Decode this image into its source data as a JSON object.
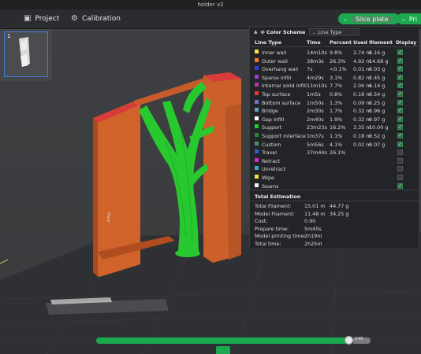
{
  "window": {
    "title": "holder v2"
  },
  "toolbar": {
    "project_label": "Project",
    "calibration_label": "Calibration",
    "slice_label": "Slice plate",
    "print_label": "Pri"
  },
  "plate": {
    "number": "1"
  },
  "legend": {
    "title": "Color Scheme",
    "scheme_value": "Line Type",
    "columns": [
      "Line Type",
      "Time",
      "Percent",
      "Used filament",
      "Display"
    ],
    "rows": [
      {
        "name": "Inner wall",
        "time": "14m10s",
        "percent": "9.8%",
        "len": "2.74 m",
        "weight": "8.16 g",
        "color": "#f3e54b",
        "display": true
      },
      {
        "name": "Outer wall",
        "time": "38m3s",
        "percent": "26.3%",
        "len": "4.92 m",
        "weight": "14.68 g",
        "color": "#f07a2a",
        "display": true
      },
      {
        "name": "Overhang wall",
        "time": "7s",
        "percent": "<0.1%",
        "len": "0.01 m",
        "weight": "0.03 g",
        "color": "#2a3ee0",
        "display": true
      },
      {
        "name": "Sparse infill",
        "time": "4m29s",
        "percent": "3.1%",
        "len": "0.82 m",
        "weight": "2.45 g",
        "color": "#a33ad0",
        "display": true
      },
      {
        "name": "Internal solid infill",
        "time": "11m10s",
        "percent": "7.7%",
        "len": "2.06 m",
        "weight": "6.14 g",
        "color": "#b23a9a",
        "display": true
      },
      {
        "name": "Top surface",
        "time": "1m5s",
        "percent": "0.8%",
        "len": "0.18 m",
        "weight": "0.54 g",
        "color": "#e0373b",
        "display": true
      },
      {
        "name": "Bottom surface",
        "time": "1m50s",
        "percent": "1.3%",
        "len": "0.09 m",
        "weight": "0.25 g",
        "color": "#6c76c7",
        "display": true
      },
      {
        "name": "Bridge",
        "time": "2m30s",
        "percent": "1.7%",
        "len": "0.32 m",
        "weight": "0.96 g",
        "color": "#5aa2b2",
        "display": true
      },
      {
        "name": "Gap infill",
        "time": "2m40s",
        "percent": "1.9%",
        "len": "0.32 m",
        "weight": "0.97 g",
        "color": "#ffffff",
        "display": true
      },
      {
        "name": "Support",
        "time": "23m23s",
        "percent": "16.2%",
        "len": "3.35 m",
        "weight": "10.00 g",
        "color": "#22cc2a",
        "display": true
      },
      {
        "name": "Support interface",
        "time": "1m37s",
        "percent": "1.1%",
        "len": "0.18 m",
        "weight": "0.52 g",
        "color": "#2a8a2e",
        "display": true
      },
      {
        "name": "Custom",
        "time": "5m56s",
        "percent": "4.1%",
        "len": "0.02 m",
        "weight": "0.07 g",
        "color": "#4c8f72",
        "display": true
      },
      {
        "name": "Travel",
        "time": "37m44s",
        "percent": "26.1%",
        "len": "",
        "weight": "",
        "color": "#2b62c8",
        "display": false
      },
      {
        "name": "Retract",
        "time": "",
        "percent": "",
        "len": "",
        "weight": "",
        "color": "#cc2ad0",
        "display": false
      },
      {
        "name": "Unretract",
        "time": "",
        "percent": "",
        "len": "",
        "weight": "",
        "color": "#3aa6c8",
        "display": false
      },
      {
        "name": "Wipe",
        "time": "",
        "percent": "",
        "len": "",
        "weight": "",
        "color": "#f0e34a",
        "display": false
      },
      {
        "name": "Seams",
        "time": "",
        "percent": "",
        "len": "",
        "weight": "",
        "color": "#f2f2f2",
        "display": true
      }
    ]
  },
  "totals": {
    "heading": "Total Estimation",
    "items": [
      {
        "label": "Total Filament:",
        "value": "15.01 m",
        "value2": "44.77 g"
      },
      {
        "label": "Model Filament:",
        "value": "11.48 m",
        "value2": "34.25 g"
      },
      {
        "label": "Cost:",
        "value": "0.90",
        "value2": ""
      },
      {
        "label": "Prepare time:",
        "value": "5m45s",
        "value2": ""
      },
      {
        "label": "Model printing time:",
        "value": "2h19m",
        "value2": ""
      },
      {
        "label": "Total time:",
        "value": "2h25m",
        "value2": ""
      }
    ]
  },
  "layer_slider": {
    "value": "246",
    "fill_fraction": 0.97
  }
}
